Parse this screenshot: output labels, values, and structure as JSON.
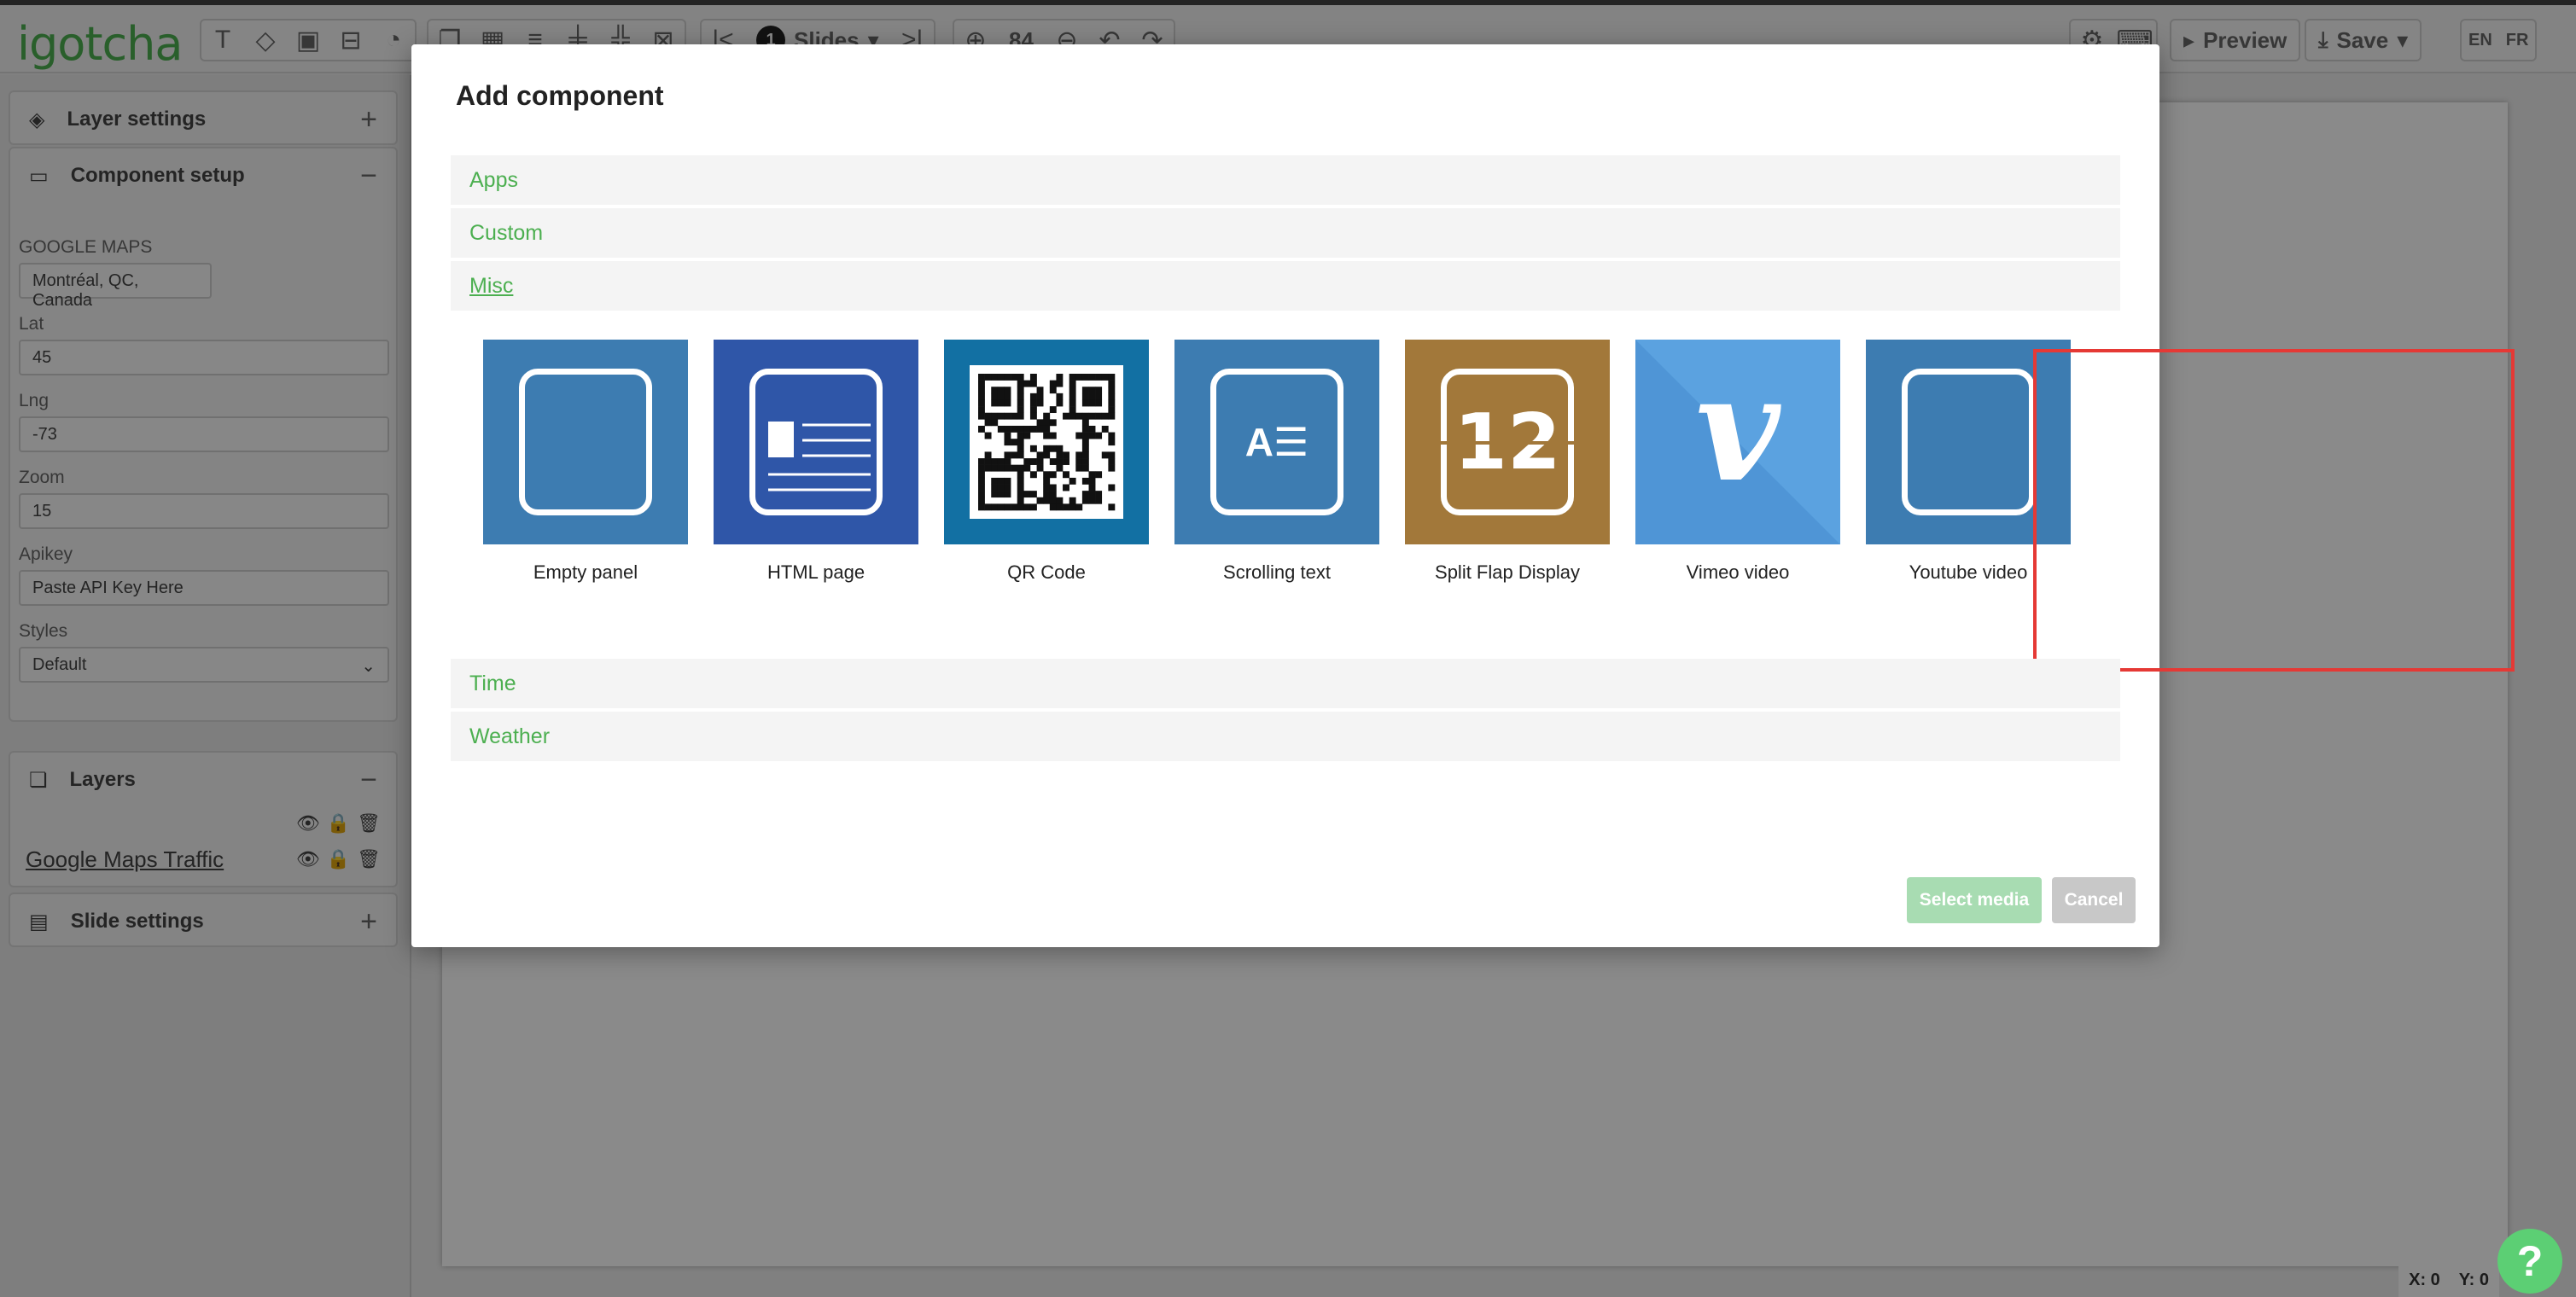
{
  "app": {
    "logo": "igotcha",
    "toolbar": {
      "slide_count": "1",
      "slides_label": "Slides",
      "zoom": "84",
      "preview_label": "Preview",
      "save_label": "Save",
      "lang_en": "EN",
      "lang_fr": "FR"
    },
    "sidebar": {
      "layer_settings": "Layer settings",
      "component_setup": "Component setup",
      "google_maps_label": "GOOGLE MAPS",
      "location_value": "Montréal, QC, Canada",
      "lat_label": "Lat",
      "lat_value": "45",
      "lng_label": "Lng",
      "lng_value": "-73",
      "zoom_label": "Zoom",
      "zoom_value": "15",
      "apikey_label": "Apikey",
      "apikey_placeholder": "Paste API Key Here",
      "styles_label": "Styles",
      "styles_value": "Default",
      "layers": "Layers",
      "layer_name": "Google Maps Traffic",
      "slide_settings": "Slide settings"
    },
    "coords": {
      "x_label": "X:",
      "x_value": "0",
      "y_label": "Y:",
      "y_value": "0"
    },
    "help": "?"
  },
  "modal": {
    "title": "Add component",
    "categories": [
      "Apps",
      "Custom",
      "Misc",
      "Time",
      "Weather"
    ],
    "active_category": "Misc",
    "tiles": [
      {
        "name": "Empty panel",
        "icon": "empty-panel-icon",
        "color": "#3d7cb1"
      },
      {
        "name": "HTML page",
        "icon": "html-page-icon",
        "color": "#2f56a8"
      },
      {
        "name": "QR Code",
        "icon": "qr-code-icon",
        "color": "#1270a3"
      },
      {
        "name": "Scrolling text",
        "icon": "scrolling-text-icon",
        "color": "#3d7cb1"
      },
      {
        "name": "Split Flap Display",
        "icon": "split-flap-icon",
        "color": "#a2783a"
      },
      {
        "name": "Vimeo video",
        "icon": "vimeo-icon",
        "color": "#5ba2e0"
      },
      {
        "name": "Youtube video",
        "icon": "youtube-icon",
        "color": "#3d7cb1"
      }
    ],
    "scrolling_text_glyph": "A☰",
    "split_flap_glyph": "12",
    "vimeo_glyph": "v",
    "select_label": "Select media",
    "cancel_label": "Cancel",
    "highlight_color": "#e53935"
  }
}
